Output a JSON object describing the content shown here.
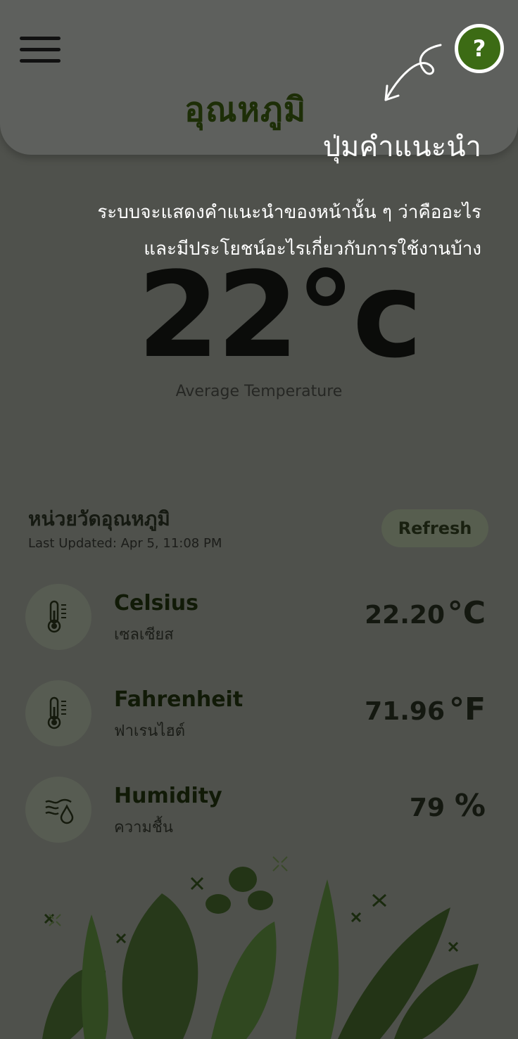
{
  "header": {
    "title": "อุณหภูมิ",
    "menu_icon": "hamburger-menu-icon",
    "help_label": "?"
  },
  "tip": {
    "title": "ปุ่มคำแนะนำ",
    "line1": "ระบบจะแสดงคำแนะนำของหน้านั้น ๆ ว่าคืออะไร",
    "line2": "และมีประโยชน์อะไรเกี่ยวกับการใช้งานบ้าง"
  },
  "main": {
    "temperature": "22°c",
    "temperature_label": "Average Temperature"
  },
  "units": {
    "title": "หน่วยวัดอุณหภูมิ",
    "last_updated": "Last Updated: Apr 5, 11:08 PM",
    "refresh_label": "Refresh",
    "rows": [
      {
        "name": "Celsius",
        "sub": "เซลเซียส",
        "value": "22.20",
        "unit": "°C",
        "icon": "thermometer-icon"
      },
      {
        "name": "Fahrenheit",
        "sub": "ฟาเรนไฮต์",
        "value": "71.96",
        "unit": "°F",
        "icon": "thermometer-icon"
      },
      {
        "name": "Humidity",
        "sub": "ความชื้น",
        "value": "79",
        "unit": "%",
        "icon": "humidity-icon"
      }
    ]
  },
  "colors": {
    "overlay_bg": "#4f514c",
    "header_bg": "#5e605d",
    "accent_green": "#3c6b14",
    "tip_text": "#ffffff"
  }
}
